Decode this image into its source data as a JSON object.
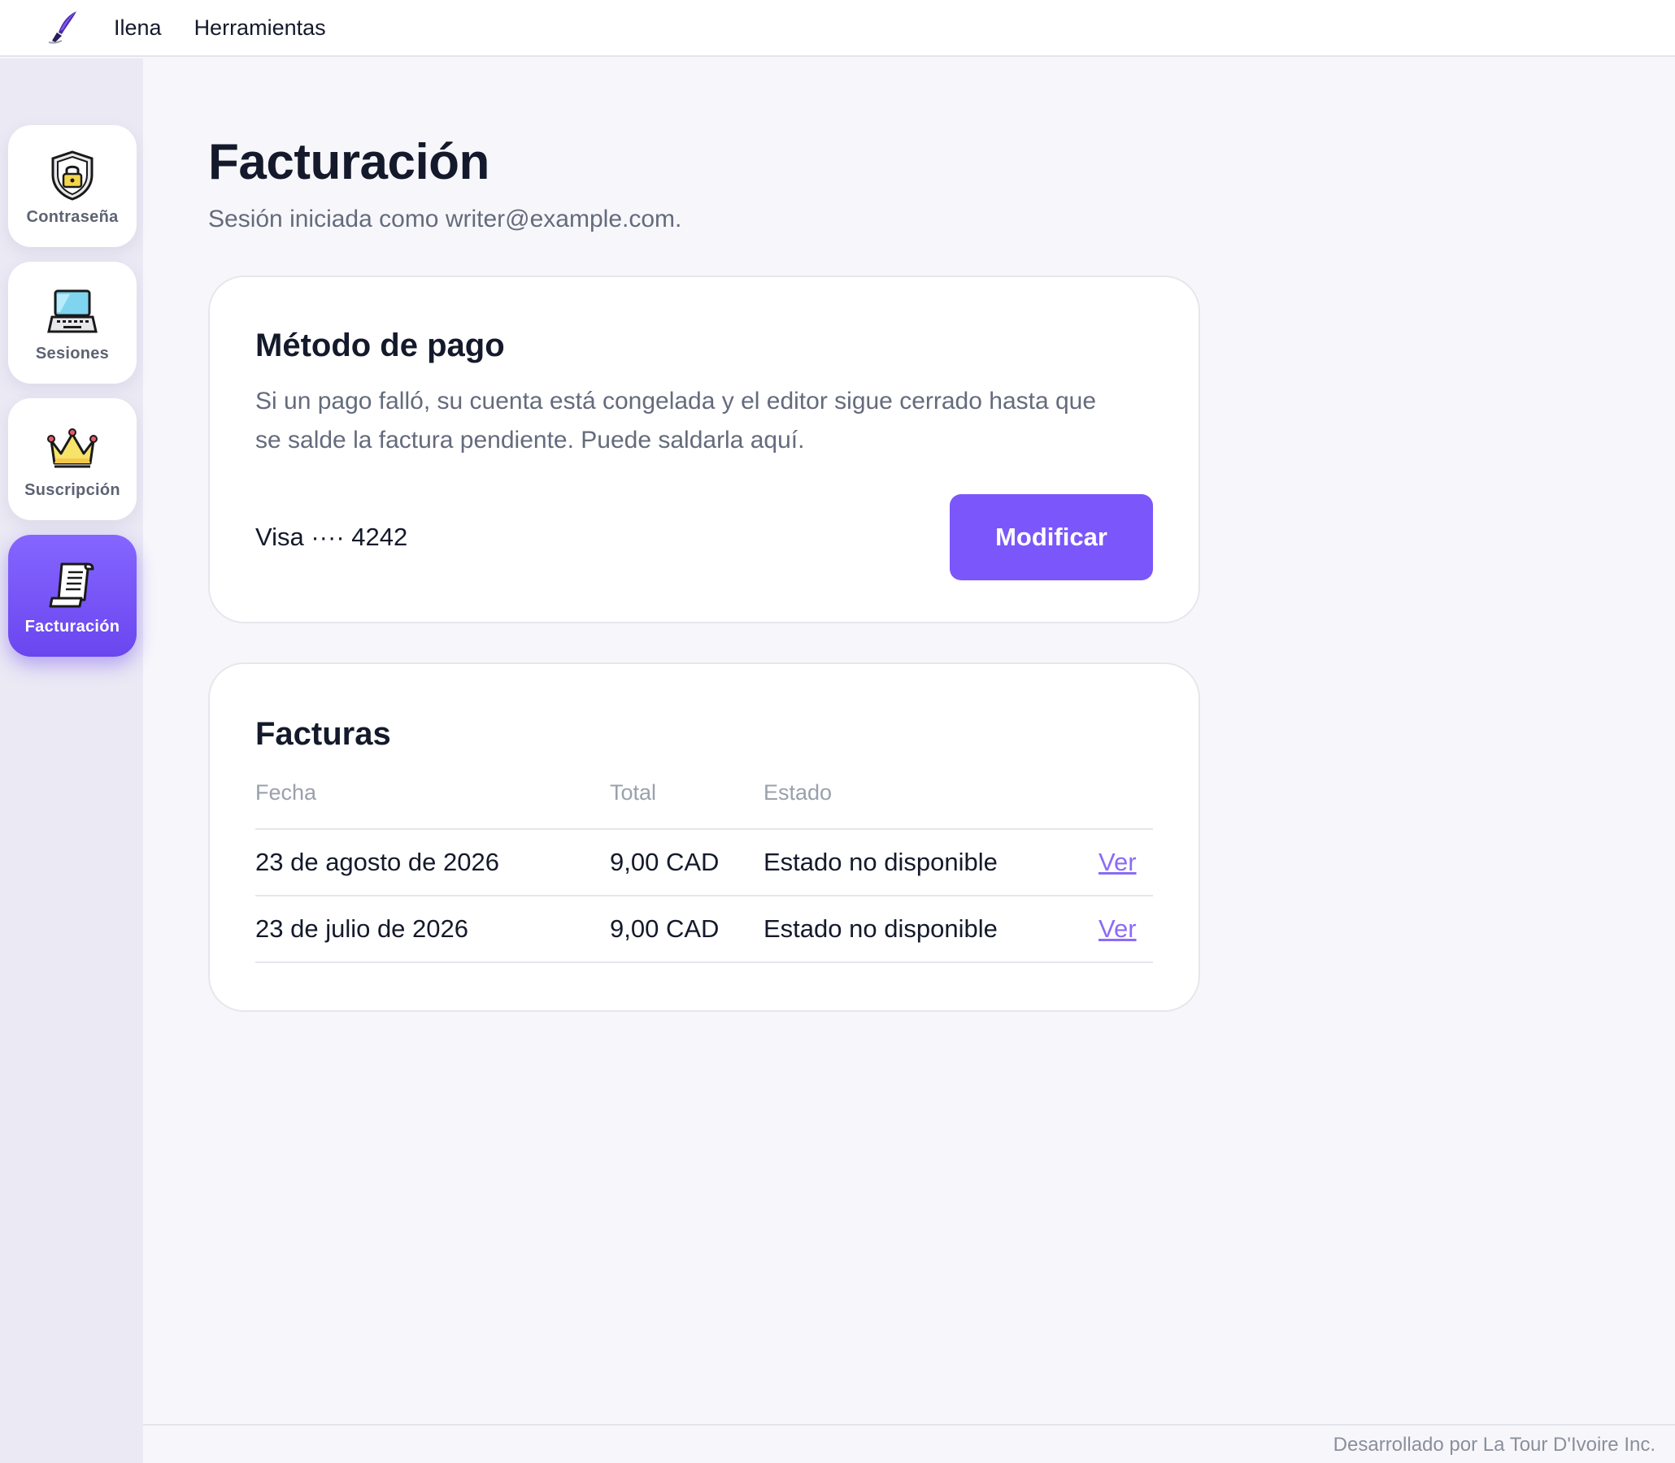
{
  "topnav": {
    "logo_icon": "quill-pen-icon",
    "links": [
      "Ilena",
      "Herramientas"
    ]
  },
  "sidebar": {
    "items": [
      {
        "label": "Contraseña",
        "icon": "shield-lock-icon",
        "active": false
      },
      {
        "label": "Sesiones",
        "icon": "laptop-icon",
        "active": false
      },
      {
        "label": "Suscripción",
        "icon": "crown-icon",
        "active": false
      },
      {
        "label": "Facturación",
        "icon": "receipt-scroll-icon",
        "active": true
      }
    ]
  },
  "page": {
    "title": "Facturación",
    "subtitle": "Sesión iniciada como writer@example.com."
  },
  "payment": {
    "title": "Método de pago",
    "description": "Si un pago falló, su cuenta está congelada y el editor sigue cerrado hasta que se salde la factura pendiente. Puede saldarla aquí.",
    "card": "Visa ···· 4242",
    "button": "Modificar"
  },
  "invoices": {
    "title": "Facturas",
    "columns": [
      "Fecha",
      "Total",
      "Estado"
    ],
    "rows": [
      {
        "date": "23 de agosto de 2026",
        "total": "9,00 CAD",
        "status": "Estado no disponible",
        "link": "Ver"
      },
      {
        "date": "23 de julio de 2026",
        "total": "9,00 CAD",
        "status": "Estado no disponible",
        "link": "Ver"
      }
    ]
  },
  "footer": {
    "text": "Desarrollado por La Tour D'Ivoire Inc."
  },
  "colors": {
    "accent": "#7b57fb",
    "link": "#8a6cf7",
    "sidebar_bg": "#ebe9f4",
    "page_bg": "#f7f7fb"
  }
}
